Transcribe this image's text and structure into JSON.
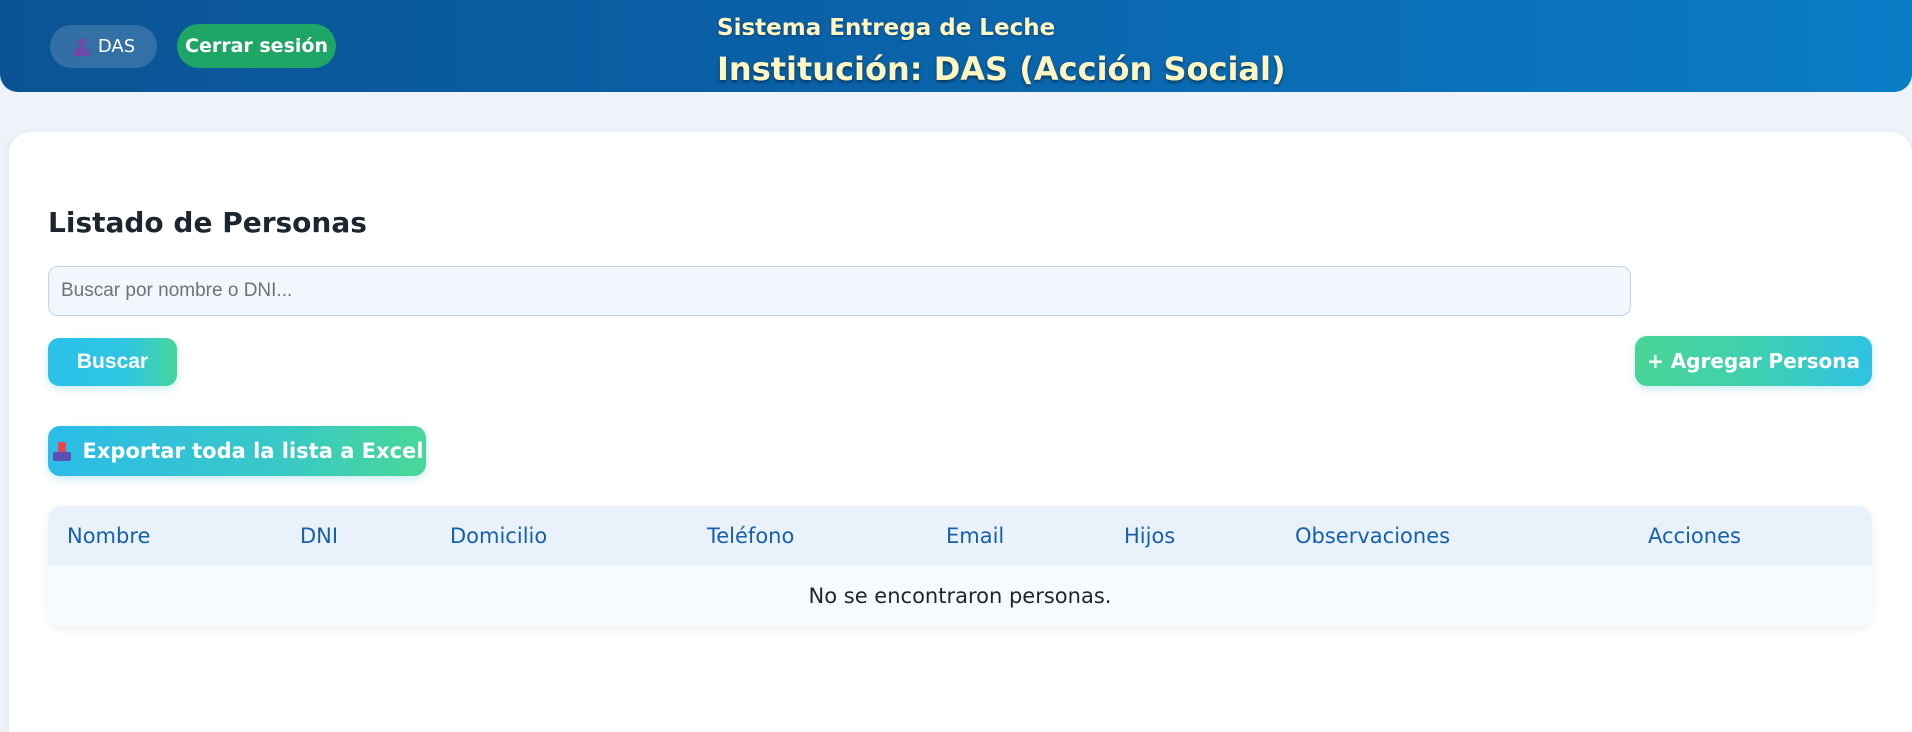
{
  "header": {
    "user_label": "DAS",
    "logout_label": "Cerrar sesión",
    "system_title": "Sistema Entrega de Leche",
    "institution_title": "Institución: DAS (Acción Social)"
  },
  "main": {
    "section_title": "Listado de Personas",
    "search": {
      "placeholder": "Buscar por nombre o DNI...",
      "value": ""
    },
    "search_button": "Buscar",
    "add_button": "+ Agregar Persona",
    "export_button": "Exportar toda la lista a Excel"
  },
  "table": {
    "columns": [
      "Nombre",
      "DNI",
      "Domicilio",
      "Teléfono",
      "Email",
      "Hijos",
      "Observaciones",
      "Acciones"
    ],
    "empty_message": "No se encontraron personas."
  },
  "icons": {
    "user": "user-icon",
    "export": "inbox-tray-icon"
  },
  "colors": {
    "header_start": "#0b5394",
    "header_end": "#0a7cc7",
    "logout_green": "#1fa566",
    "title_yellow": "#fff6c2",
    "table_header_text": "#1560a8"
  }
}
